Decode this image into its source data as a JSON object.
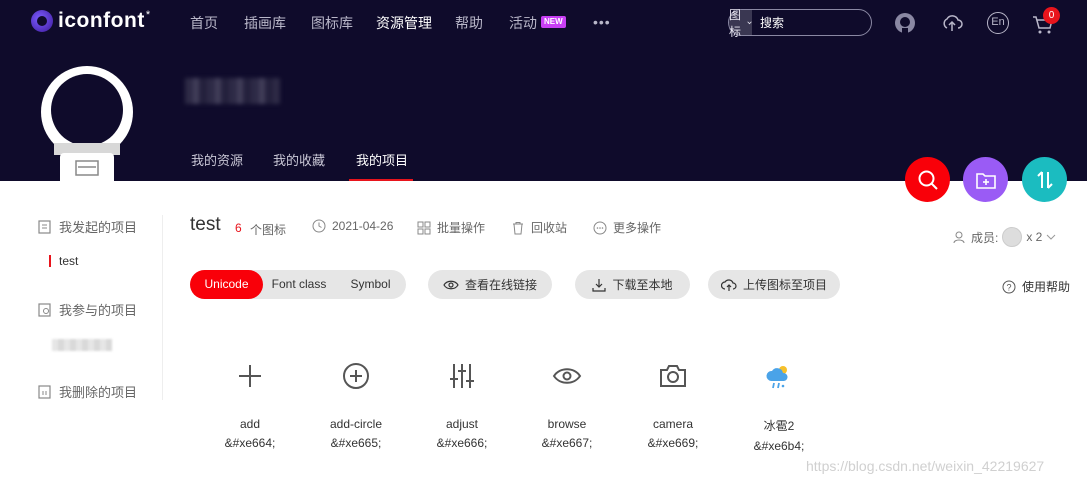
{
  "brand": {
    "name": "iconfont",
    "star": "*"
  },
  "nav": {
    "items": [
      {
        "label": "首页"
      },
      {
        "label": "插画库"
      },
      {
        "label": "图标库"
      },
      {
        "label": "资源管理"
      },
      {
        "label": "帮助"
      },
      {
        "label": "活动"
      }
    ],
    "new_badge": "NEW",
    "more": "•••",
    "active_index": 3
  },
  "search": {
    "type_label": "图标",
    "placeholder": "搜索"
  },
  "header_icons": [
    "github-icon",
    "upload-icon",
    "language-en-icon",
    "cart-icon"
  ],
  "language_label": "En",
  "cart_count": "0",
  "profile": {
    "tabs": [
      {
        "label": "我的资源"
      },
      {
        "label": "我的收藏"
      },
      {
        "label": "我的项目"
      }
    ],
    "active_tab": 2
  },
  "fabs": [
    {
      "icon": "search-icon",
      "color": "#f90009"
    },
    {
      "icon": "add-folder-icon",
      "color": "#9a5bf5"
    },
    {
      "icon": "sort-icon",
      "color": "#1bbcc0"
    }
  ],
  "sidebar": {
    "created": "我发起的项目",
    "created_items": [
      {
        "label": "test"
      }
    ],
    "joined": "我参与的项目",
    "deleted": "我删除的项目"
  },
  "project": {
    "title": "test",
    "count": "6",
    "count_label": "个图标",
    "date": "2021-04-26",
    "batch": "批量操作",
    "trash": "回收站",
    "more_ops": "更多操作",
    "members_label": "成员:",
    "members_count": "x 2"
  },
  "segments": [
    {
      "label": "Unicode"
    },
    {
      "label": "Font class"
    },
    {
      "label": "Symbol"
    }
  ],
  "actions": {
    "view_link": "查看在线链接",
    "download": "下载至本地",
    "upload": "上传图标至项目",
    "help": "使用帮助"
  },
  "icons": [
    {
      "name": "add",
      "code": "&#xe664;",
      "glyph": "plus-icon"
    },
    {
      "name": "add-circle",
      "code": "&#xe665;",
      "glyph": "add-circle-icon"
    },
    {
      "name": "adjust",
      "code": "&#xe666;",
      "glyph": "adjust-icon"
    },
    {
      "name": "browse",
      "code": "&#xe667;",
      "glyph": "eye-icon"
    },
    {
      "name": "camera",
      "code": "&#xe669;",
      "glyph": "camera-icon"
    },
    {
      "name": "冰雹2",
      "code": "&#xe6b4;",
      "glyph": "hail-weather-icon"
    }
  ],
  "watermark": "https://blog.csdn.net/weixin_42219627"
}
